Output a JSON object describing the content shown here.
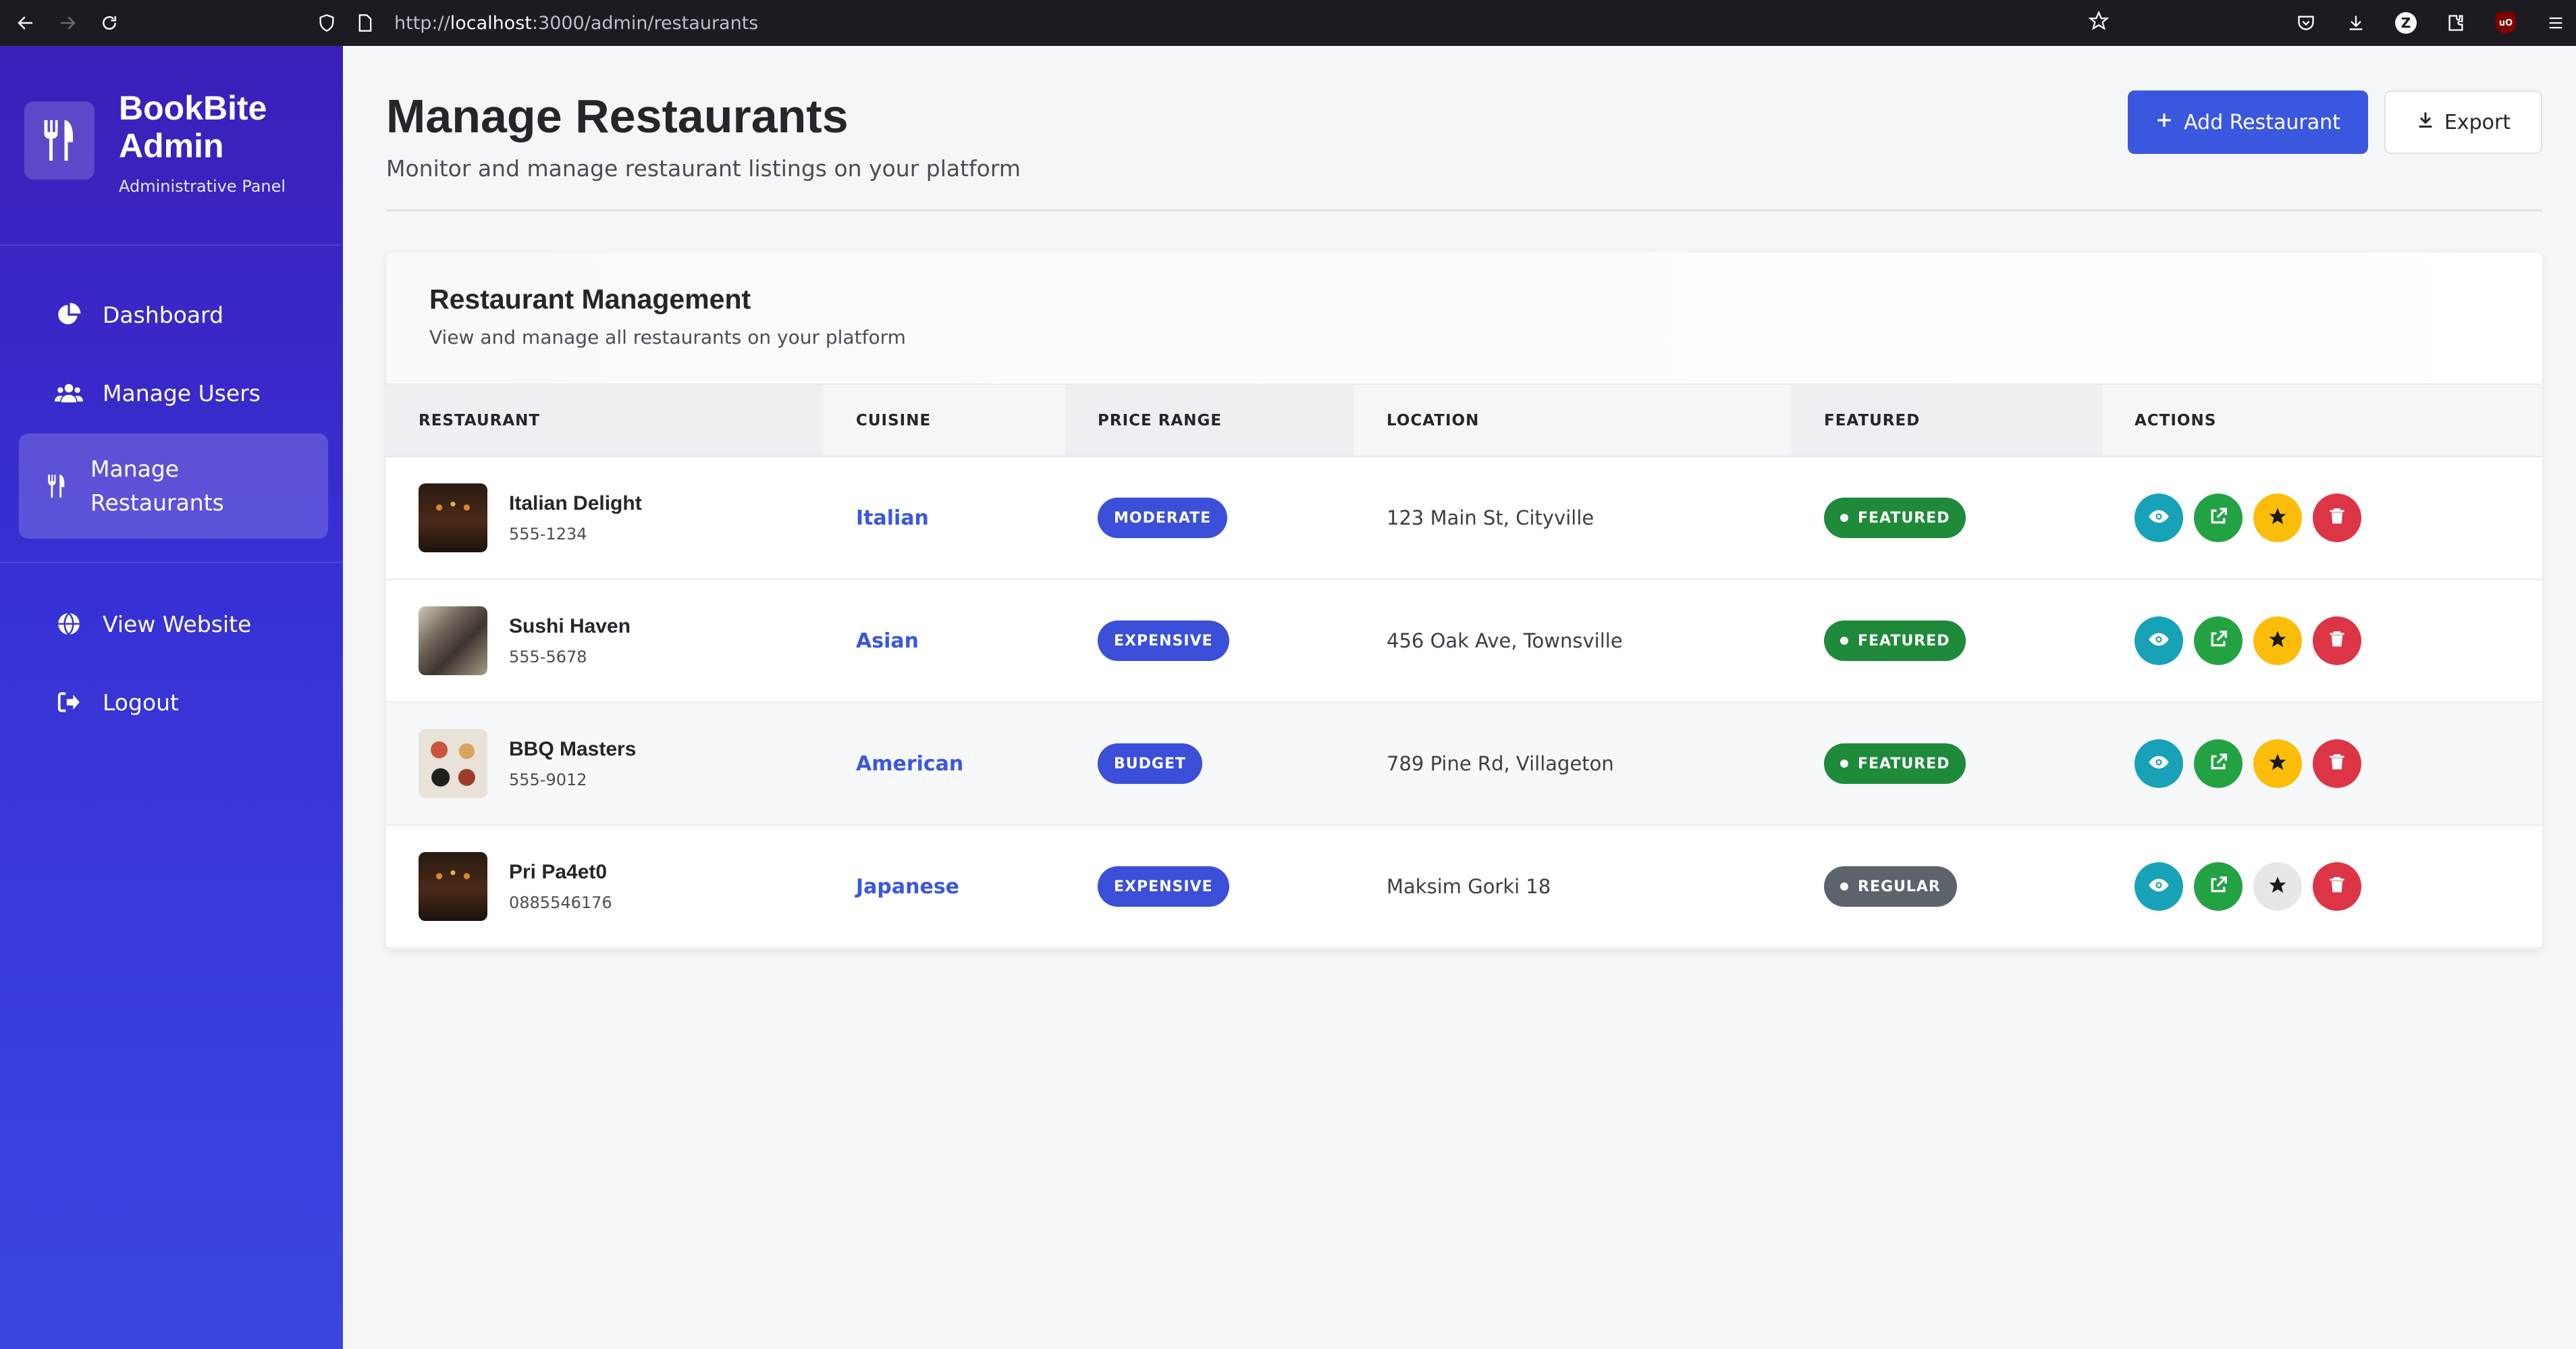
{
  "browser": {
    "url_prefix": "http://",
    "url_host": "localhost",
    "url_rest": ":3000/admin/restaurants"
  },
  "sidebar": {
    "brand_title": "BookBite Admin",
    "brand_subtitle": "Administrative Panel",
    "items": [
      {
        "label": "Dashboard",
        "icon": "chart-pie-icon"
      },
      {
        "label": "Manage Users",
        "icon": "users-icon"
      },
      {
        "label": "Manage Restaurants",
        "icon": "utensils-icon",
        "active": true
      },
      {
        "label": "View Website",
        "icon": "globe-icon"
      },
      {
        "label": "Logout",
        "icon": "logout-icon"
      }
    ]
  },
  "header": {
    "title": "Manage Restaurants",
    "subtitle": "Monitor and manage restaurant listings on your platform",
    "add_label": "Add Restaurant",
    "export_label": "Export"
  },
  "card": {
    "title": "Restaurant Management",
    "subtitle": "View and manage all restaurants on your platform"
  },
  "table": {
    "columns": [
      "RESTAURANT",
      "CUISINE",
      "PRICE RANGE",
      "LOCATION",
      "FEATURED",
      "ACTIONS"
    ],
    "rows": [
      {
        "name": "Italian Delight",
        "phone": "555-1234",
        "cuisine": "Italian",
        "price": "MODERATE",
        "location": "123 Main St, Cityville",
        "featured": "FEATURED",
        "is_featured": true
      },
      {
        "name": "Sushi Haven",
        "phone": "555-5678",
        "cuisine": "Asian",
        "price": "EXPENSIVE",
        "location": "456 Oak Ave, Townsville",
        "featured": "FEATURED",
        "is_featured": true
      },
      {
        "name": "BBQ Masters",
        "phone": "555-9012",
        "cuisine": "American",
        "price": "BUDGET",
        "location": "789 Pine Rd, Villageton",
        "featured": "FEATURED",
        "is_featured": true
      },
      {
        "name": "Pri Pa4et0",
        "phone": "0885546176",
        "cuisine": "Japanese",
        "price": "EXPENSIVE",
        "location": "Maksim Gorki 18",
        "featured": "REGULAR",
        "is_featured": false
      }
    ]
  },
  "colors": {
    "accent": "#3b57e0",
    "sidebar_top": "#3a1fb8",
    "sidebar_bottom": "#3a46e0",
    "featured": "#1e8a3a",
    "regular": "#5c636b",
    "view": "#17a2b8",
    "open": "#23a244",
    "star": "#fbbd08",
    "delete": "#dc3545"
  }
}
